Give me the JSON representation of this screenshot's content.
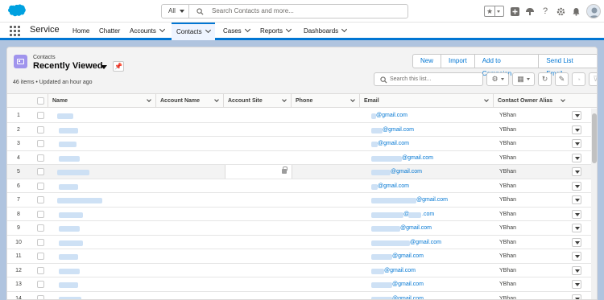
{
  "header": {
    "search_scope": "All",
    "search_placeholder": "Search Contacts and more..."
  },
  "nav": {
    "app_name": "Service",
    "items": [
      {
        "label": "Home"
      },
      {
        "label": "Chatter"
      },
      {
        "label": "Accounts"
      },
      {
        "label": "Contacts"
      },
      {
        "label": "Cases"
      },
      {
        "label": "Reports"
      },
      {
        "label": "Dashboards"
      }
    ]
  },
  "list": {
    "object_label": "Contacts",
    "title": "Recently Viewed",
    "meta": "46 items • Updated an hour ago",
    "buttons": {
      "new": "New",
      "import": "Import",
      "add_to_campaign": "Add to Campaign",
      "send_list_email": "Send List Email"
    },
    "search_placeholder": "Search this list...",
    "columns": {
      "name": "Name",
      "account_name": "Account Name",
      "account_site": "Account Site",
      "phone": "Phone",
      "email": "Email",
      "owner": "Contact Owner Alias"
    },
    "rows": [
      {
        "num": "1",
        "email": "@gmail.com",
        "owner": "YBhan"
      },
      {
        "num": "2",
        "email": "@gmail.com",
        "owner": "YBhan"
      },
      {
        "num": "3",
        "email": "@gmail.com",
        "owner": "YBhan"
      },
      {
        "num": "4",
        "email": "@gmail.com",
        "owner": "YBhan"
      },
      {
        "num": "5",
        "email": "@gmail.com",
        "owner": "YBhan"
      },
      {
        "num": "6",
        "email": "@gmail.com",
        "owner": "YBhan"
      },
      {
        "num": "7",
        "email": "@gmail.com",
        "owner": "YBhan"
      },
      {
        "num": "8",
        "email": ".com",
        "owner": "YBhan"
      },
      {
        "num": "9",
        "email": "@gmail.com",
        "owner": "YBhan"
      },
      {
        "num": "10",
        "email": "@gmail.com",
        "owner": "YBhan"
      },
      {
        "num": "11",
        "email": "@gmail.com",
        "owner": "YBhan"
      },
      {
        "num": "12",
        "email": "@gmail.com",
        "owner": "YBhan"
      },
      {
        "num": "13",
        "email": "@gmail.com",
        "owner": "YBhan"
      },
      {
        "num": "14",
        "email": "@gmail.com",
        "owner": "YBhan"
      }
    ]
  },
  "colors": {
    "brand": "#0176d3",
    "background": "#b0c4df",
    "object_icon": "#a094ed"
  },
  "icons": [
    "salesforce-logo",
    "search-icon",
    "star-icon",
    "plus-icon",
    "trailhead-icon",
    "help-icon",
    "gear-icon",
    "bell-icon",
    "avatar",
    "waffle-icon",
    "contact-card-icon",
    "pin-icon",
    "list-settings-icon",
    "table-view-icon",
    "refresh-icon",
    "pencil-icon",
    "chart-icon",
    "filter-icon",
    "lock-icon"
  ]
}
